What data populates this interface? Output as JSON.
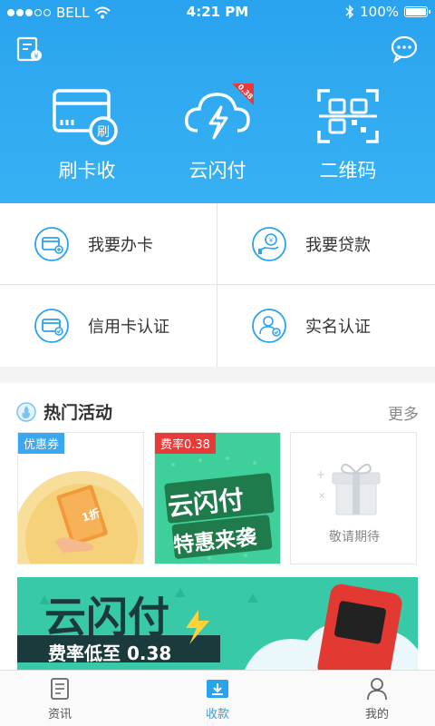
{
  "status": {
    "carrier": "BELL",
    "time": "4:21 PM",
    "battery": "100%"
  },
  "header": {
    "actions": [
      {
        "label": "刷卡收",
        "icon": "card-swipe-icon"
      },
      {
        "label": "云闪付",
        "icon": "cloud-flash-pay-icon",
        "badge": "0.38"
      },
      {
        "label": "二维码",
        "icon": "qr-code-icon"
      }
    ]
  },
  "services": [
    {
      "label": "我要办卡",
      "icon": "apply-card-icon"
    },
    {
      "label": "我要贷款",
      "icon": "loan-icon"
    },
    {
      "label": "信用卡认证",
      "icon": "credit-card-verify-icon"
    },
    {
      "label": "实名认证",
      "icon": "identity-verify-icon"
    }
  ],
  "hot": {
    "title": "热门活动",
    "more": "更多",
    "cards": [
      {
        "tag": "优惠券",
        "text": "1折"
      },
      {
        "tag": "费率0.38",
        "line1": "云闪付",
        "line2": "特惠来袭"
      },
      {
        "text": "敬请期待"
      }
    ],
    "banner": {
      "title": "云闪付",
      "subtitle": "费率低至 0.38"
    }
  },
  "tabs": [
    {
      "label": "资讯",
      "icon": "news-icon",
      "active": false
    },
    {
      "label": "收款",
      "icon": "receive-payment-icon",
      "active": true
    },
    {
      "label": "我的",
      "icon": "profile-icon",
      "active": false
    }
  ],
  "colors": {
    "primary": "#2aa3ef",
    "accent_red": "#e93a3a",
    "green": "#3ccf9a"
  }
}
